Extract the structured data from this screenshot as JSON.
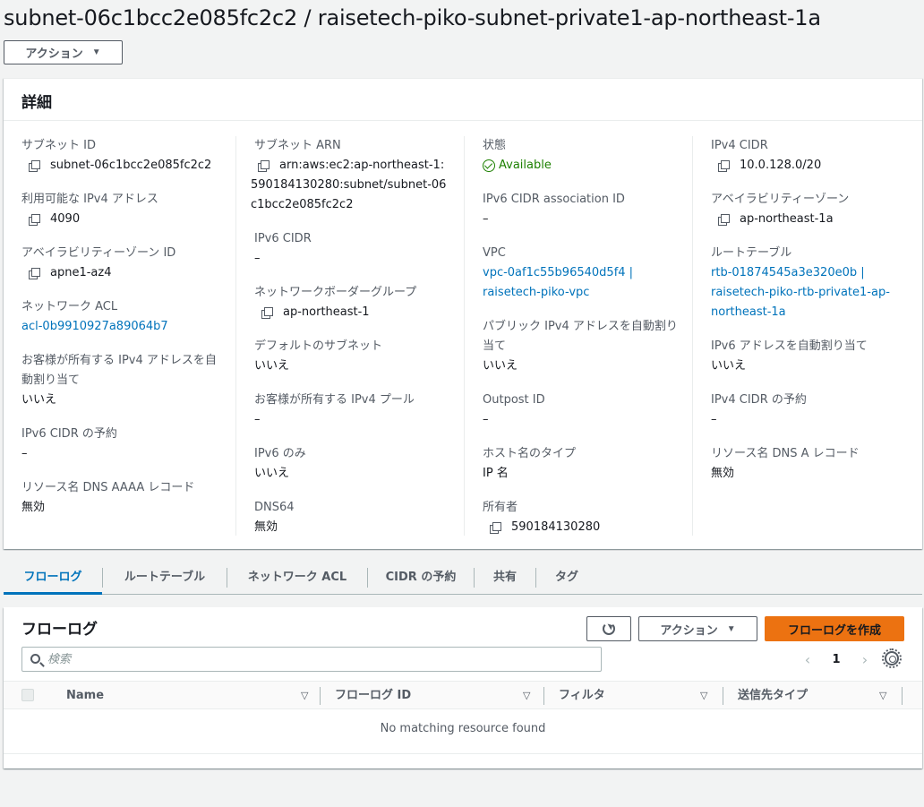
{
  "header": {
    "title": "subnet-06c1bcc2e085fc2c2 / raisetech-piko-subnet-private1-ap-northeast-1a",
    "actions_label": "アクション"
  },
  "details": {
    "title": "詳細",
    "col1": [
      {
        "label": "サブネット ID",
        "value": "subnet-06c1bcc2e085fc2c2"
      },
      {
        "label": "利用可能な IPv4 アドレス",
        "value": "4090"
      },
      {
        "label": "アベイラビリティーゾーン ID",
        "value": "apne1-az4"
      },
      {
        "label": "ネットワーク ACL",
        "value": "acl-0b9910927a89064b7"
      },
      {
        "label": "お客様が所有する IPv4 アドレスを自動割り当て",
        "value": "いいえ"
      },
      {
        "label": "IPv6 CIDR の予約",
        "value": "–"
      },
      {
        "label": "リソース名 DNS AAAA レコード",
        "value": "無効"
      }
    ],
    "col2": [
      {
        "label": "サブネット ARN",
        "value": "arn:aws:ec2:ap-northeast-1:590184130280:subnet/subnet-06c1bcc2e085fc2c2"
      },
      {
        "label": "IPv6 CIDR",
        "value": "–"
      },
      {
        "label": "ネットワークボーダーグループ",
        "value": "ap-northeast-1"
      },
      {
        "label": "デフォルトのサブネット",
        "value": "いいえ"
      },
      {
        "label": "お客様が所有する IPv4 プール",
        "value": "–"
      },
      {
        "label": "IPv6 のみ",
        "value": "いいえ"
      },
      {
        "label": "DNS64",
        "value": "無効"
      }
    ],
    "col3": [
      {
        "label": "状態",
        "value": "Available"
      },
      {
        "label": "IPv6 CIDR association ID",
        "value": "–"
      },
      {
        "label": "VPC",
        "value": "vpc-0af1c55b96540d5f4 | raisetech-piko-vpc"
      },
      {
        "label": "パブリック IPv4 アドレスを自動割り当て",
        "value": "いいえ"
      },
      {
        "label": "Outpost ID",
        "value": "–"
      },
      {
        "label": "ホスト名のタイプ",
        "value": "IP 名"
      },
      {
        "label": "所有者",
        "value": "590184130280"
      }
    ],
    "col4": [
      {
        "label": "IPv4 CIDR",
        "value": "10.0.128.0/20"
      },
      {
        "label": "アベイラビリティーゾーン",
        "value": "ap-northeast-1a"
      },
      {
        "label": "ルートテーブル",
        "value": "rtb-01874545a3e320e0b | raisetech-piko-rtb-private1-ap-northeast-1a"
      },
      {
        "label": "IPv6 アドレスを自動割り当て",
        "value": "いいえ"
      },
      {
        "label": "IPv4 CIDR の予約",
        "value": "–"
      },
      {
        "label": "リソース名 DNS A レコード",
        "value": "無効"
      }
    ]
  },
  "tabs": [
    "フローログ",
    "ルートテーブル",
    "ネットワーク ACL",
    "CIDR の予約",
    "共有",
    "タグ"
  ],
  "flow_logs": {
    "title": "フローログ",
    "actions_label": "アクション",
    "create_label": "フローログを作成",
    "search_placeholder": "検索",
    "page": "1",
    "columns": [
      "Name",
      "フローログ ID",
      "フィルタ",
      "送信先タイプ"
    ],
    "empty_message": "No matching resource found"
  },
  "colors": {
    "link": "#0073bb",
    "success": "#1d8102",
    "primary": "#ec7211"
  }
}
